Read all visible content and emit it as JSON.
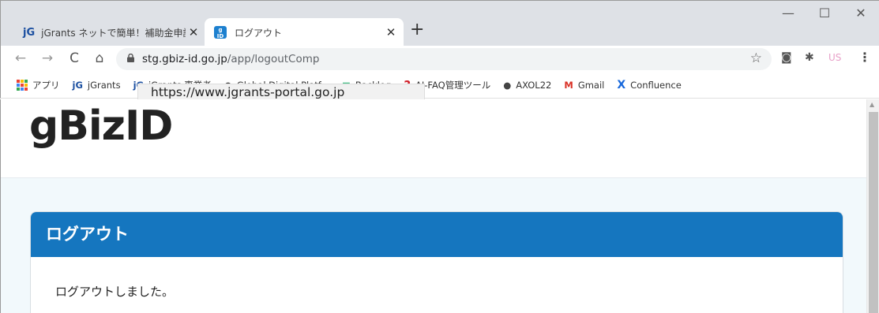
{
  "tabs": [
    {
      "favicon": "jG",
      "title": "jGrants ネットで簡単！補助金申請",
      "close": "✕"
    },
    {
      "favicon": "gBiz\nID",
      "title": "ログアウト",
      "close": "✕"
    }
  ],
  "new_tab": "+",
  "window_controls": {
    "minimize": "—",
    "maximize": "☐",
    "close": "✕"
  },
  "address": {
    "host": "stg.gbiz-id.go.jp",
    "path": "/app/logoutComp"
  },
  "nav": {
    "back": "←",
    "forward": "→",
    "reload": "C",
    "home": "⌂",
    "star": "☆",
    "camera": "◙",
    "extensions": "✱",
    "profile": "US",
    "menu": "⋮"
  },
  "bookmarks": [
    {
      "icon": "apps-icon",
      "label": "アプリ"
    },
    {
      "icon": "jG",
      "label": "jGrants"
    },
    {
      "icon": "jG",
      "label": "jGrants 事業者"
    },
    {
      "icon": "globe",
      "label": "Global Digital Platf..."
    },
    {
      "icon": "green",
      "label": "Backlog"
    },
    {
      "icon": "?",
      "label": "AI-FAQ管理ツール"
    },
    {
      "icon": "globe",
      "label": "AXOL22"
    },
    {
      "icon": "M",
      "label": "Gmail"
    },
    {
      "icon": "X",
      "label": "Confluence"
    }
  ],
  "tooltip": "https://www.jgrants-portal.go.jp",
  "page": {
    "logo": "gBizID",
    "panel_title": "ログアウト",
    "message": "ログアウトしました。"
  },
  "colors": {
    "panel_header": "#1576bf",
    "content_bg": "#f2f9fc"
  }
}
